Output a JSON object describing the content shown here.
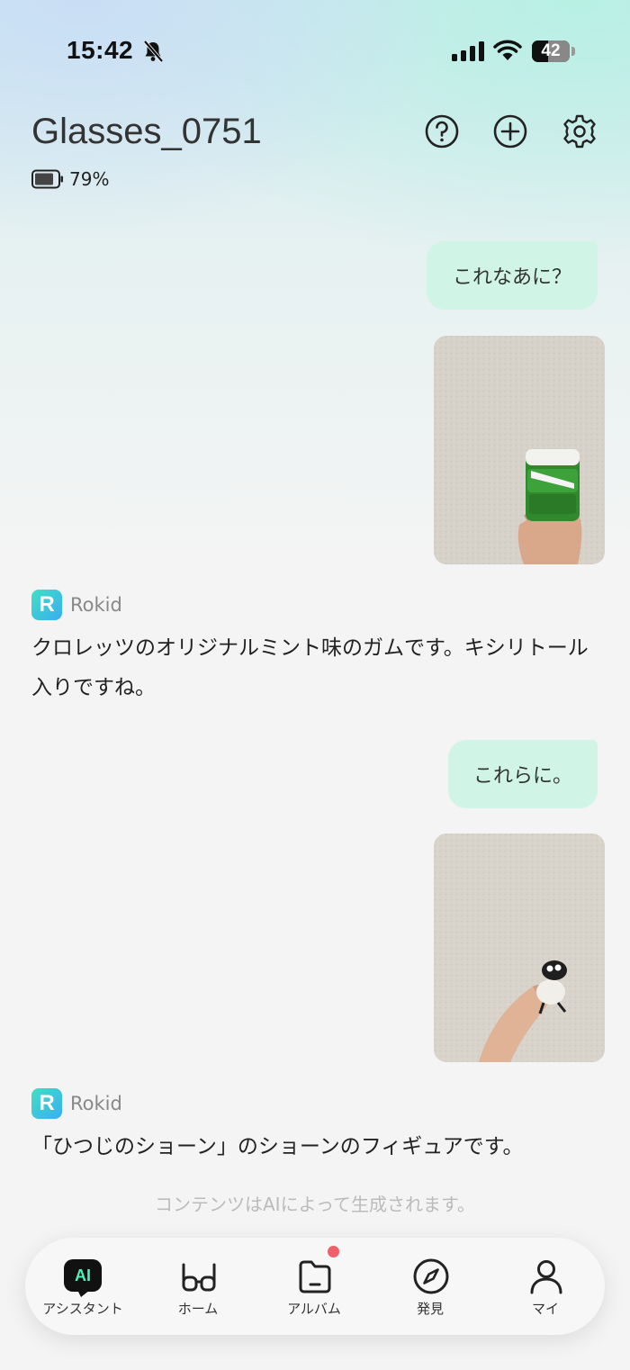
{
  "status_bar": {
    "time": "15:42",
    "battery": "42"
  },
  "header": {
    "device_name": "Glasses_0751",
    "device_battery": "79%"
  },
  "chat": {
    "messages": [
      {
        "text": "これなあに？"
      },
      {
        "text": "これらに。"
      }
    ],
    "replies": [
      {
        "sender": "Rokid",
        "text": "クロレッツのオリジナルミント味のガムです。キシリトール入りですね。"
      },
      {
        "sender": "Rokid",
        "text": "「ひつじのショーン」のショーンのフィギュアです。"
      }
    ],
    "logo_letter": "R",
    "disclaimer": "コンテンツはAIによって生成されます。"
  },
  "tabs": [
    {
      "label": "アシスタント",
      "icon": "ai-icon",
      "badge": "AI"
    },
    {
      "label": "ホーム",
      "icon": "glasses-icon"
    },
    {
      "label": "アルバム",
      "icon": "album-folder-icon",
      "notification": true
    },
    {
      "label": "発見",
      "icon": "compass-icon"
    },
    {
      "label": "マイ",
      "icon": "person-icon"
    }
  ],
  "colors": {
    "bubble": "#d0f5e6",
    "accent": "#4ef0b6",
    "notification": "#f0606a"
  }
}
